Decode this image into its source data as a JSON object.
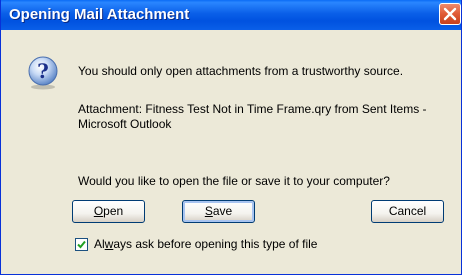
{
  "window": {
    "title": "Opening Mail Attachment"
  },
  "icons": {
    "title_close": "close-icon",
    "dialog": "question-icon"
  },
  "message": {
    "line1": "You should only open attachments from a trustworthy source.",
    "attachment": "Attachment: Fitness Test Not in Time Frame.qry from Sent Items - Microsoft Outlook",
    "question": "Would you like to open the file or save it to your computer?"
  },
  "buttons": {
    "open_mnemonic": "O",
    "open_rest": "pen",
    "save_mnemonic": "S",
    "save_rest": "ave",
    "cancel": "Cancel"
  },
  "checkbox": {
    "checked": true,
    "label_pre": "Al",
    "label_mnemonic": "w",
    "label_post": "ays ask before opening this type of file"
  },
  "colors": {
    "title_bar": "#0a5fe8",
    "close_button": "#e05a36",
    "dialog_bg": "#ece9d8"
  }
}
